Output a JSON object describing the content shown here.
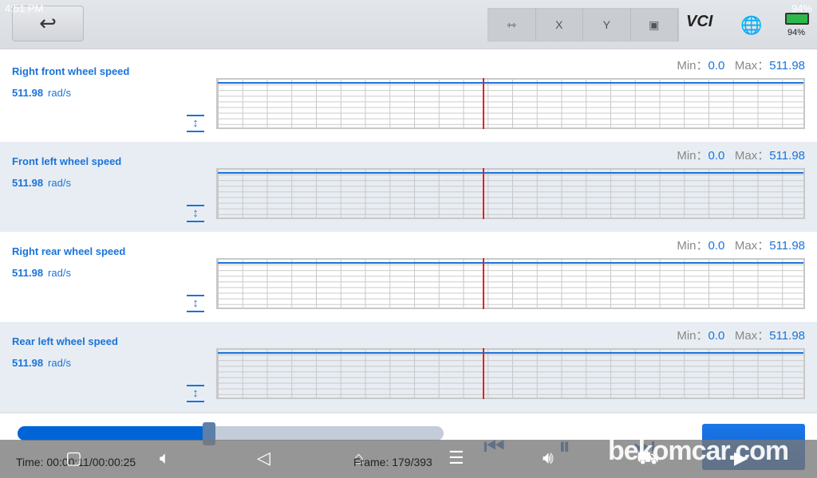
{
  "status": {
    "time": "4:51 PM",
    "battery": "94%"
  },
  "toolbar": {
    "tools": [
      "expand-width",
      "X",
      "Y",
      "monitor"
    ],
    "vci": "VCI",
    "battery_pct": "94%"
  },
  "panels": [
    {
      "name": "Right front wheel speed",
      "value": "511.98",
      "unit": "rad/s",
      "min_label": "Min：",
      "min": "0.0",
      "max_label": "Max：",
      "max": "511.98"
    },
    {
      "name": "Front left wheel speed",
      "value": "511.98",
      "unit": "rad/s",
      "min_label": "Min：",
      "min": "0.0",
      "max_label": "Max：",
      "max": "511.98"
    },
    {
      "name": "Right rear wheel speed",
      "value": "511.98",
      "unit": "rad/s",
      "min_label": "Min：",
      "min": "0.0",
      "max_label": "Max：",
      "max": "511.98"
    },
    {
      "name": "Rear left wheel speed",
      "value": "511.98",
      "unit": "rad/s",
      "min_label": "Min：",
      "min": "0.0",
      "max_label": "Max：",
      "max": "511.98"
    }
  ],
  "playback": {
    "progress_percent": 45,
    "time": "Time: 00:00:11/00:00:25",
    "frame": "Frame: 179/393"
  },
  "watermark": "bekomcar.com",
  "colors": {
    "accent": "#1a73d9",
    "cursor": "#e52020"
  }
}
